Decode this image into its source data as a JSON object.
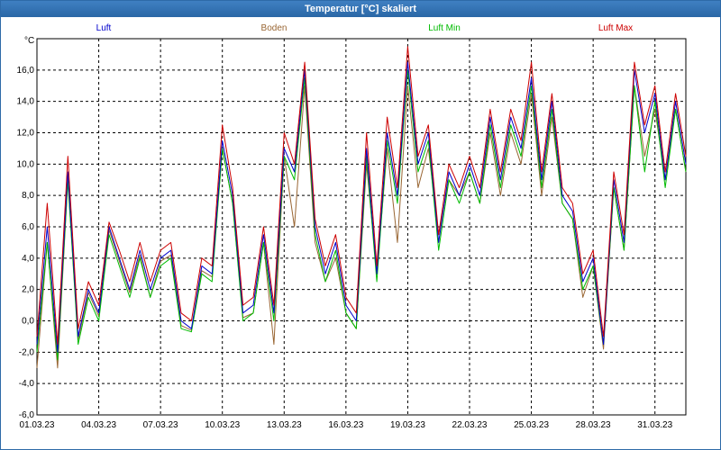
{
  "window": {
    "title": "Temperatur [°C] skaliert"
  },
  "chart_data": {
    "type": "line",
    "title": "Temperatur [°C] skaliert",
    "ylabel": "°C",
    "xlabel": "",
    "ylim": [
      -6,
      18
    ],
    "xlim": [
      "01.03.23 00:00",
      "01.04.23 12:00"
    ],
    "yticks": [
      -6,
      -4,
      -2,
      0,
      2,
      4,
      6,
      8,
      10,
      12,
      14,
      16
    ],
    "ytick_labels": [
      "-6,0",
      "-4,0",
      "-2,0",
      "0,0",
      "2,0",
      "4,0",
      "6,0",
      "8,0",
      "10,0",
      "12,0",
      "14,0",
      "16,0"
    ],
    "xtick_labels": [
      "01.03.23",
      "04.03.23",
      "07.03.23",
      "10.03.23",
      "13.03.23",
      "16.03.23",
      "19.03.23",
      "22.03.23",
      "25.03.23",
      "28.03.23",
      "31.03.23"
    ],
    "grid": true,
    "legend_position": "top",
    "x": [
      "01.03.23 00:00",
      "01.03.23 12:00",
      "02.03.23 00:00",
      "02.03.23 12:00",
      "03.03.23 00:00",
      "03.03.23 12:00",
      "04.03.23 00:00",
      "04.03.23 12:00",
      "05.03.23 00:00",
      "05.03.23 12:00",
      "06.03.23 00:00",
      "06.03.23 12:00",
      "07.03.23 00:00",
      "07.03.23 12:00",
      "08.03.23 00:00",
      "08.03.23 12:00",
      "09.03.23 00:00",
      "09.03.23 12:00",
      "10.03.23 00:00",
      "10.03.23 12:00",
      "11.03.23 00:00",
      "11.03.23 12:00",
      "12.03.23 00:00",
      "12.03.23 12:00",
      "13.03.23 00:00",
      "13.03.23 12:00",
      "14.03.23 00:00",
      "14.03.23 12:00",
      "15.03.23 00:00",
      "15.03.23 12:00",
      "16.03.23 00:00",
      "16.03.23 12:00",
      "17.03.23 00:00",
      "17.03.23 12:00",
      "18.03.23 00:00",
      "18.03.23 12:00",
      "19.03.23 00:00",
      "19.03.23 12:00",
      "20.03.23 00:00",
      "20.03.23 12:00",
      "21.03.23 00:00",
      "21.03.23 12:00",
      "22.03.23 00:00",
      "22.03.23 12:00",
      "23.03.23 00:00",
      "23.03.23 12:00",
      "24.03.23 00:00",
      "24.03.23 12:00",
      "25.03.23 00:00",
      "25.03.23 12:00",
      "26.03.23 00:00",
      "26.03.23 12:00",
      "27.03.23 00:00",
      "27.03.23 12:00",
      "28.03.23 00:00",
      "28.03.23 12:00",
      "29.03.23 00:00",
      "29.03.23 12:00",
      "30.03.23 00:00",
      "30.03.23 12:00",
      "31.03.23 00:00",
      "31.03.23 12:00",
      "01.04.23 00:00",
      "01.04.23 12:00"
    ],
    "series": [
      {
        "name": "Luft",
        "color": "#0000cc",
        "values": [
          -1.5,
          6,
          -2,
          9.5,
          -1,
          2,
          0.5,
          6,
          4,
          2,
          4.5,
          2,
          4,
          4.5,
          0,
          -0.5,
          3.5,
          3,
          11.5,
          8,
          0.5,
          1,
          5.5,
          0.5,
          11,
          9.5,
          16,
          6,
          3,
          5,
          1,
          0,
          11,
          3,
          12,
          8,
          16.5,
          10,
          12,
          5,
          9.5,
          8,
          10,
          8,
          13,
          9,
          13,
          11,
          15.5,
          9,
          14,
          8,
          7,
          2.5,
          4,
          -1.5,
          9,
          5,
          16,
          12,
          14.5,
          9,
          14,
          10
        ]
      },
      {
        "name": "Boden",
        "color": "#996633",
        "values": [
          -3,
          5,
          -3,
          9,
          -1.2,
          1.8,
          0.3,
          5.8,
          3.8,
          1.8,
          4.2,
          1.5,
          3.8,
          4.2,
          -0.3,
          -0.6,
          3.2,
          2.8,
          11,
          7.5,
          0.2,
          0.5,
          5,
          -1.5,
          10.5,
          6,
          15,
          5,
          2.5,
          4,
          0.5,
          -0.5,
          10,
          3,
          11,
          5,
          15,
          8.5,
          11,
          5.5,
          9,
          8,
          9.5,
          7.5,
          12,
          8,
          12,
          10,
          14.5,
          8,
          13,
          7.5,
          6.5,
          1.5,
          3.5,
          -1.8,
          8.5,
          4.5,
          15,
          10.5,
          13.5,
          9,
          13.5,
          9.5
        ]
      },
      {
        "name": "Luft Min",
        "color": "#00bb00",
        "values": [
          -2,
          5,
          -2.5,
          9,
          -1.5,
          1.5,
          0,
          5.5,
          3.5,
          1.5,
          4,
          1.5,
          3.5,
          4,
          -0.5,
          -0.7,
          3,
          2.5,
          11,
          7.5,
          0,
          0.5,
          5,
          0,
          10.5,
          9,
          15.5,
          5.5,
          2.5,
          4.5,
          0.5,
          -0.5,
          10.5,
          2.5,
          11.5,
          7.5,
          16,
          9.5,
          11.5,
          4.5,
          9,
          7.5,
          9.5,
          7.5,
          12.5,
          8.5,
          12.5,
          10.5,
          15,
          8.5,
          13.5,
          7.5,
          6.5,
          2,
          3.5,
          -1.5,
          8.5,
          4.5,
          15,
          9.5,
          14,
          8.5,
          13.5,
          9.5
        ]
      },
      {
        "name": "Luft Max",
        "color": "#cc0000",
        "values": [
          -1,
          7.5,
          -1.5,
          10.5,
          -0.5,
          2.5,
          1,
          6.3,
          4.5,
          2.5,
          5,
          2.5,
          4.5,
          5,
          0.5,
          0,
          4,
          3.5,
          12.5,
          8.5,
          1,
          1.5,
          6,
          1,
          12,
          10,
          16.5,
          6.5,
          3.5,
          5.5,
          1.5,
          0.5,
          12,
          3.5,
          13,
          8.5,
          17.5,
          10.5,
          12.5,
          5.5,
          10,
          8.5,
          10.5,
          8.5,
          13.5,
          9.5,
          13.5,
          11.5,
          16.5,
          9.5,
          14.5,
          8.5,
          7.5,
          3,
          4.5,
          -1,
          9.5,
          5.5,
          16.5,
          12.5,
          15,
          9.5,
          14.5,
          10.5
        ]
      }
    ]
  }
}
